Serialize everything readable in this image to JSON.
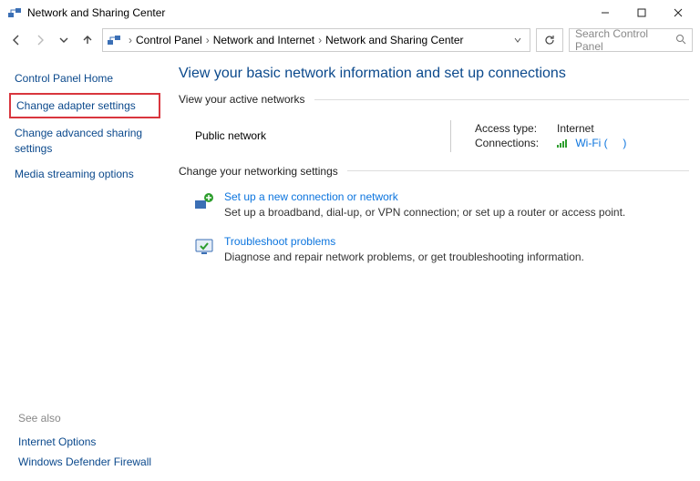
{
  "window": {
    "title": "Network and Sharing Center"
  },
  "breadcrumb": {
    "root": "Control Panel",
    "mid": "Network and Internet",
    "leaf": "Network and Sharing Center"
  },
  "search": {
    "placeholder": "Search Control Panel"
  },
  "sidebar": {
    "home": "Control Panel Home",
    "adapter": "Change adapter settings",
    "advanced": "Change advanced sharing settings",
    "media": "Media streaming options"
  },
  "main": {
    "heading": "View your basic network information and set up connections",
    "active_label": "View your active networks",
    "network_name": "Public network",
    "access_key": "Access type:",
    "access_val": "Internet",
    "conn_key": "Connections:",
    "conn_val": "Wi-Fi (",
    "conn_val_tail": ")",
    "change_label": "Change your networking settings",
    "setup": {
      "title": "Set up a new connection or network",
      "desc": "Set up a broadband, dial-up, or VPN connection; or set up a router or access point."
    },
    "trouble": {
      "title": "Troubleshoot problems",
      "desc": "Diagnose and repair network problems, or get troubleshooting information."
    }
  },
  "seealso": {
    "title": "See also",
    "opt1": "Internet Options",
    "opt2": "Windows Defender Firewall"
  }
}
